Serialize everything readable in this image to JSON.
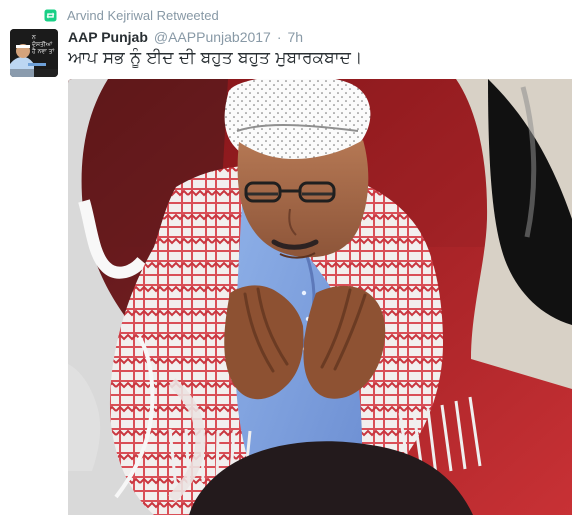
{
  "retweet": {
    "label": "Arvind Kejriwal Retweeted",
    "icon": "retweet-icon",
    "color": "#19cf86"
  },
  "tweet": {
    "name": "AAP Punjab",
    "handle": "@AAPPunjab2017",
    "separator": "·",
    "time": "7h",
    "text": "ਆਪ ਸਭ ਨੂੰ ਈਦ ਦੀ ਬਹੁਤ ਬਹੁਤ ਮੁਬਾਰਕਬਾਦ।",
    "avatar_caption": "ਨ\nਦੋਸਤੀਆਂ\nਹੈ ਨਵਾ ਤਾਂ",
    "text_color": "#292f33",
    "meta_color": "#8899a6"
  },
  "media": {
    "icon": "photo-image"
  }
}
